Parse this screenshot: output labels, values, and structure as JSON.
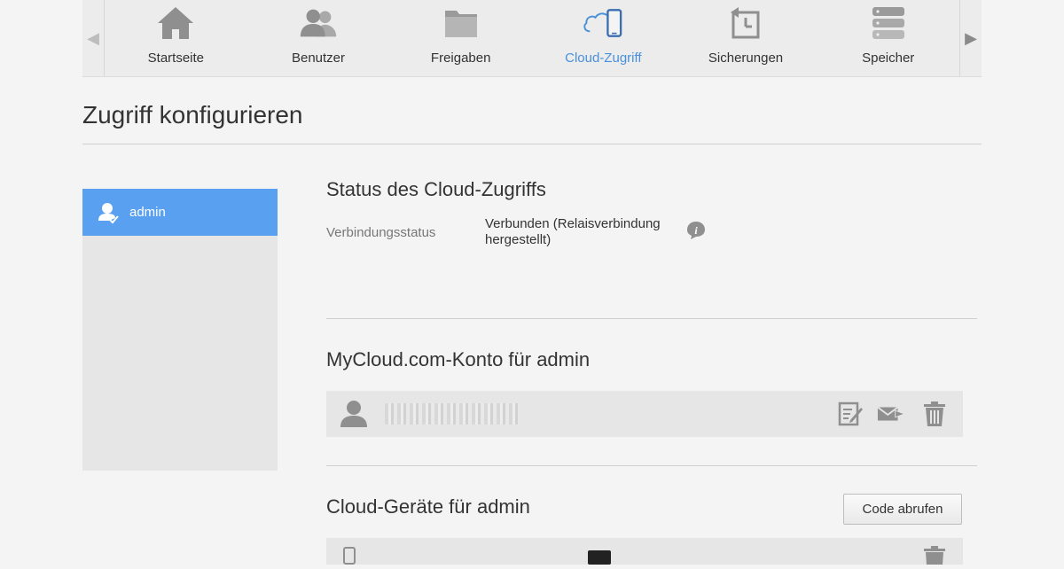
{
  "nav": {
    "items": [
      {
        "label": "Startseite",
        "icon": "home-icon"
      },
      {
        "label": "Benutzer",
        "icon": "users-icon"
      },
      {
        "label": "Freigaben",
        "icon": "folder-icon"
      },
      {
        "label": "Cloud-Zugriff",
        "icon": "cloud-device-icon",
        "active": true
      },
      {
        "label": "Sicherungen",
        "icon": "backup-icon"
      },
      {
        "label": "Speicher",
        "icon": "storage-icon"
      }
    ],
    "prev_arrow": "◀",
    "next_arrow": "▶"
  },
  "page": {
    "title": "Zugriff konfigurieren"
  },
  "sidebar": {
    "users": [
      {
        "name": "admin",
        "selected": true
      }
    ]
  },
  "status": {
    "title": "Status des Cloud-Zugriffs",
    "label": "Verbindungsstatus",
    "value_line1": "Verbunden (Relaisverbindung",
    "value_line2": "hergestellt)"
  },
  "account": {
    "title": "MyCloud.com-Konto für admin",
    "actions": [
      "edit-icon",
      "mail-forward-icon",
      "trash-icon"
    ]
  },
  "devices": {
    "title": "Cloud-Geräte für admin",
    "button_label": "Code abrufen"
  },
  "colors": {
    "accent": "#5aa0f0",
    "active_nav": "#4a90d9"
  }
}
